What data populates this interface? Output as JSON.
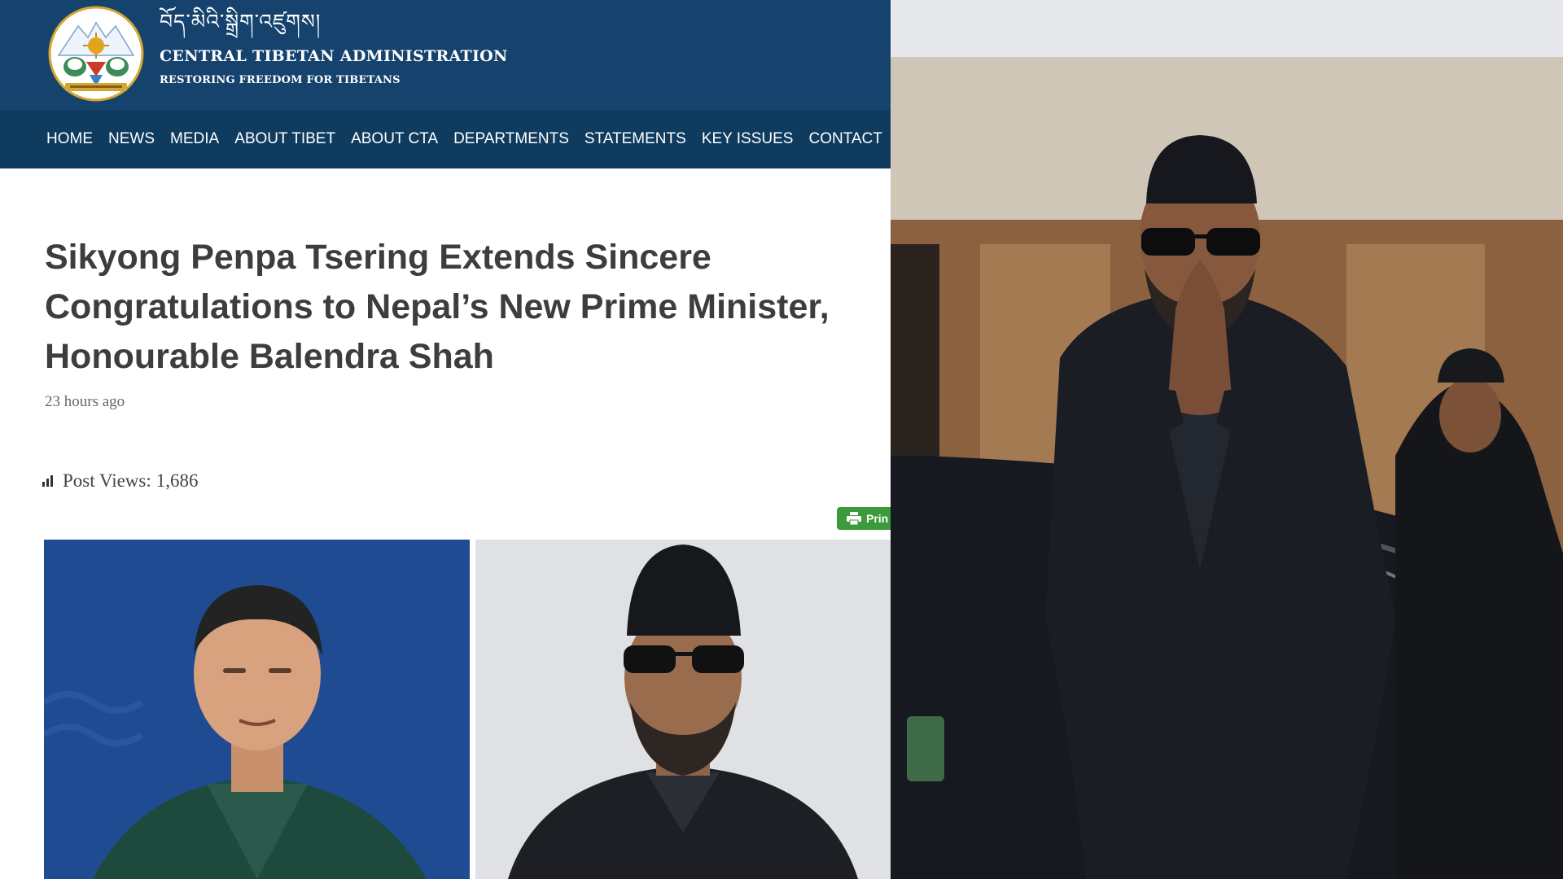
{
  "site": {
    "header": {
      "tibetan_name": "བོད་མིའི་སྒྲིག་འཛུགས།",
      "org_name": "CENTRAL TIBETAN ADMINISTRATION",
      "tagline": "RESTORING FREEDOM FOR TIBETANS",
      "logo_icon": "cta-emblem-icon"
    },
    "nav": {
      "items": [
        {
          "label": "HOME"
        },
        {
          "label": "NEWS"
        },
        {
          "label": "MEDIA"
        },
        {
          "label": "ABOUT TIBET"
        },
        {
          "label": "ABOUT CTA"
        },
        {
          "label": "DEPARTMENTS"
        },
        {
          "label": "STATEMENTS"
        },
        {
          "label": "KEY ISSUES"
        },
        {
          "label": "CONTACT"
        }
      ]
    },
    "article": {
      "title": "Sikyong Penpa Tsering Extends Sincere\nCongratulations to Nepal’s New Prime Minister,\nHonourable Balendra Shah",
      "time_ago": "23 hours ago",
      "post_views_label": "Post Views:",
      "post_views_count": "1,686",
      "stats_icon": "bar-chart-icon",
      "print_label": "Prin",
      "print_icon": "printer-icon"
    }
  },
  "colors": {
    "header_bg": "#15436e",
    "nav_bg": "#0f3b5f",
    "title_text": "#3d3d3d",
    "print_button": "#3b9a3b",
    "sikyong_photo_bg": "#1f4b92"
  }
}
